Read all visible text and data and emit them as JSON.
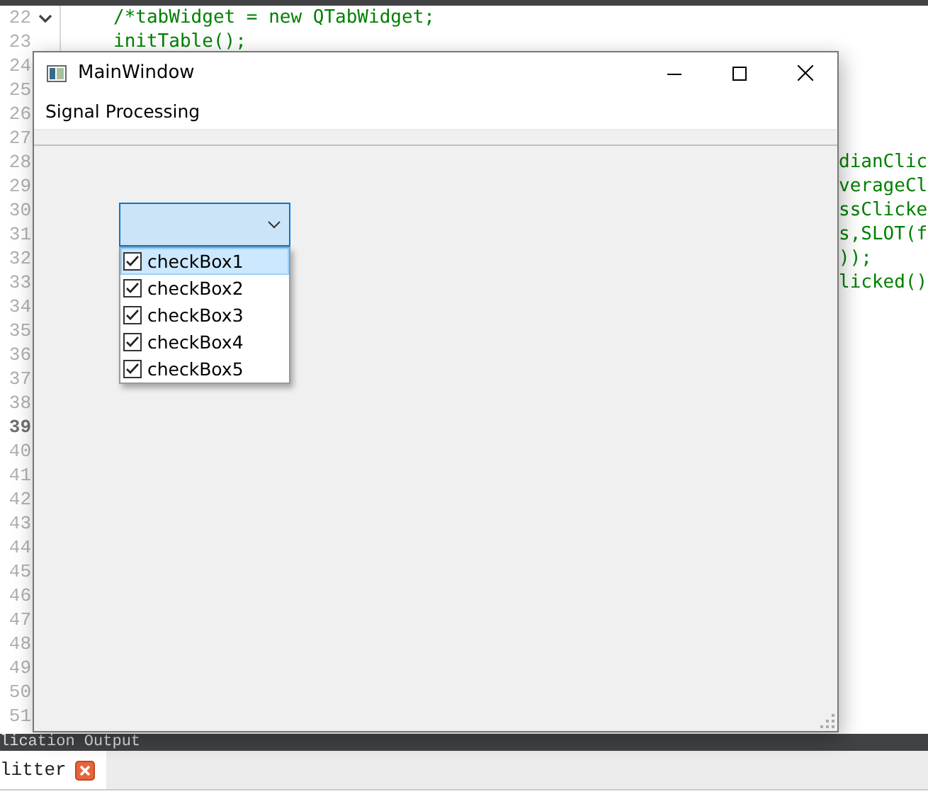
{
  "editor": {
    "lines": [
      {
        "number": "22",
        "code": "/*tabWidget = new QTabWidget;",
        "kind": "left",
        "fold": true,
        "current": false
      },
      {
        "number": "23",
        "code": "initTable();",
        "kind": "left",
        "fold": false,
        "current": false
      },
      {
        "number": "24",
        "fold": false,
        "current": false
      },
      {
        "number": "25",
        "fold": false,
        "current": false
      },
      {
        "number": "26",
        "fold": false,
        "current": false
      },
      {
        "number": "27",
        "fold": false,
        "current": false
      },
      {
        "number": "28",
        "code": "dianClic",
        "kind": "right",
        "fold": false,
        "current": false
      },
      {
        "number": "29",
        "code": "verageCl",
        "kind": "right",
        "fold": false,
        "current": false
      },
      {
        "number": "30",
        "code": "ssClicke",
        "kind": "right",
        "fold": false,
        "current": false
      },
      {
        "number": "31",
        "code": "s,SLOT(f",
        "kind": "right",
        "fold": false,
        "current": false
      },
      {
        "number": "32",
        "code": "));",
        "kind": "right",
        "fold": false,
        "current": false
      },
      {
        "number": "33",
        "code": "licked()",
        "kind": "right",
        "fold": false,
        "current": false
      },
      {
        "number": "34",
        "fold": false,
        "current": false
      },
      {
        "number": "35",
        "fold": false,
        "current": false
      },
      {
        "number": "36",
        "fold": false,
        "current": false
      },
      {
        "number": "37",
        "fold": false,
        "current": false
      },
      {
        "number": "38",
        "fold": false,
        "current": false
      },
      {
        "number": "39",
        "fold": false,
        "current": true
      },
      {
        "number": "40",
        "fold": false,
        "current": false
      },
      {
        "number": "41",
        "fold": false,
        "current": false
      },
      {
        "number": "42",
        "fold": false,
        "current": false
      },
      {
        "number": "43",
        "fold": false,
        "current": false
      },
      {
        "number": "44",
        "fold": false,
        "current": false
      },
      {
        "number": "45",
        "fold": false,
        "current": false
      },
      {
        "number": "46",
        "fold": false,
        "current": false
      },
      {
        "number": "47",
        "fold": false,
        "current": false
      },
      {
        "number": "48",
        "fold": false,
        "current": false
      },
      {
        "number": "49",
        "fold": false,
        "current": false
      },
      {
        "number": "50",
        "fold": false,
        "current": false
      },
      {
        "number": "51",
        "fold": false,
        "current": false
      }
    ]
  },
  "output_panel": {
    "title": "lication Output"
  },
  "tabs": [
    {
      "label": "litter",
      "selected": true
    }
  ],
  "window": {
    "title": "MainWindow",
    "menu": [
      "Signal Processing"
    ],
    "combo": {
      "expanded": true,
      "items": [
        {
          "label": "checkBox1",
          "checked": true,
          "selected": true
        },
        {
          "label": "checkBox2",
          "checked": true,
          "selected": false
        },
        {
          "label": "checkBox3",
          "checked": true,
          "selected": false
        },
        {
          "label": "checkBox4",
          "checked": true,
          "selected": false
        },
        {
          "label": "checkBox5",
          "checked": true,
          "selected": false
        }
      ]
    }
  }
}
